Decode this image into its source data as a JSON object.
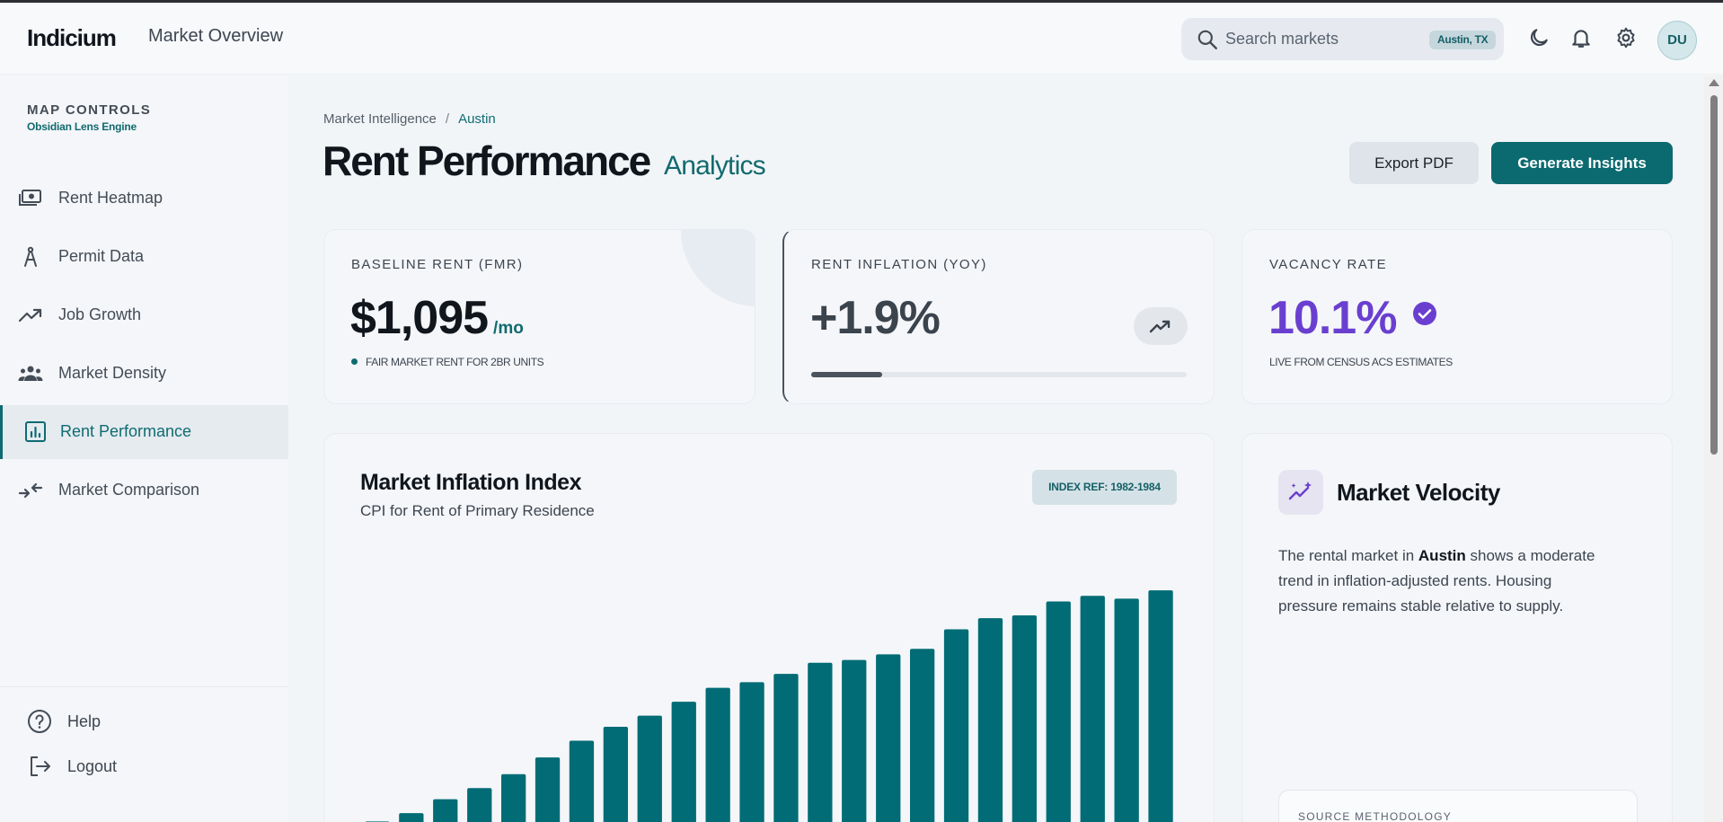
{
  "header": {
    "logo": "Indicium",
    "nav_label": "Market Overview",
    "search_placeholder": "Search markets",
    "location_badge": "Austin, TX",
    "avatar_initials": "DU",
    "icons": [
      "search-icon",
      "moon-icon",
      "bell-icon",
      "gear-icon"
    ]
  },
  "sidebar": {
    "title": "MAP CONTROLS",
    "subtitle": "Obsidian Lens Engine",
    "items": [
      {
        "label": "Rent Heatmap",
        "icon": "money-icon"
      },
      {
        "label": "Permit Data",
        "icon": "compass-icon"
      },
      {
        "label": "Job Growth",
        "icon": "trending-up-icon"
      },
      {
        "label": "Market Density",
        "icon": "group-icon"
      },
      {
        "label": "Rent Performance",
        "icon": "bar-chart-icon",
        "active": true
      },
      {
        "label": "Market Comparison",
        "icon": "compare-arrows-icon"
      }
    ],
    "footer": [
      {
        "label": "Help",
        "icon": "help-icon"
      },
      {
        "label": "Logout",
        "icon": "logout-icon"
      }
    ]
  },
  "page": {
    "breadcrumb": {
      "parent": "Market Intelligence",
      "separator": "/",
      "current": "Austin"
    },
    "title": "Rent Performance",
    "title_sub": "Analytics",
    "export_label": "Export PDF",
    "generate_label": "Generate Insights"
  },
  "kpis": {
    "baseline": {
      "label": "BASELINE RENT (FMR)",
      "value": "$1,095",
      "unit": "/mo",
      "note": "FAIR MARKET RENT FOR 2BR UNITS"
    },
    "inflation": {
      "label": "RENT INFLATION (YOY)",
      "value": "+1.9%",
      "progress": 0.19
    },
    "vacancy": {
      "label": "VACANCY RATE",
      "value": "10.1%",
      "note": "LIVE FROM CENSUS ACS ESTIMATES"
    }
  },
  "chart": {
    "title": "Market Inflation Index",
    "subtitle": "CPI for Rent of Primary Residence",
    "badge": "INDEX REF: 1982-1984"
  },
  "chart_data": {
    "type": "bar",
    "title": "Market Inflation Index",
    "subtitle": "CPI for Rent of Primary Residence",
    "xlabel": "",
    "ylabel": "",
    "grid": false,
    "series_color": "#016c75",
    "values": [
      6,
      9,
      14,
      18,
      23,
      29,
      35,
      40,
      44,
      49,
      54,
      56,
      59,
      63,
      64,
      66,
      68,
      75,
      79,
      80,
      85,
      87,
      86,
      89
    ],
    "ylim": [
      0,
      100
    ],
    "visible_fraction": 0.42
  },
  "velocity": {
    "title": "Market Velocity",
    "text_pre": "The rental market in ",
    "text_city": "Austin",
    "text_post": " shows a moderate trend in inflation-adjusted rents. Housing pressure remains stable relative to supply.",
    "source_label": "SOURCE METHODOLOGY",
    "icon": "sparkle-trend-icon"
  },
  "colors": {
    "brand": "#0b6a70",
    "accent_violet": "#6a3fd0",
    "bar": "#016c75"
  }
}
